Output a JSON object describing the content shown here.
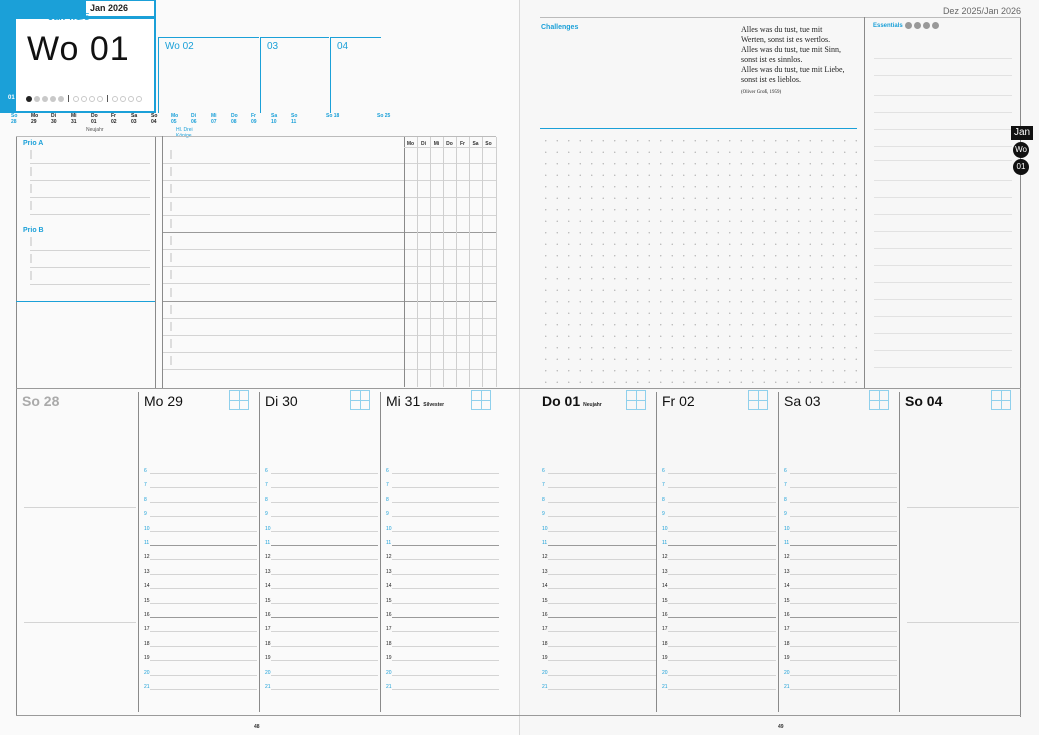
{
  "left_page": {
    "month_tab": "Jan 2026",
    "week_title": "Wo 01",
    "week_sub_month": "Jan",
    "week_sub_rest": "-w1/5",
    "week_num_small": "01",
    "day_strip": [
      {
        "d": "So",
        "n": "28",
        "c": true
      },
      {
        "d": "Mo",
        "n": "29",
        "c": false
      },
      {
        "d": "Di",
        "n": "30",
        "c": false
      },
      {
        "d": "Mi",
        "n": "31",
        "c": false
      },
      {
        "d": "Do",
        "n": "01",
        "c": false
      },
      {
        "d": "Fr",
        "n": "02",
        "c": false
      },
      {
        "d": "Sa",
        "n": "03",
        "c": false
      },
      {
        "d": "So",
        "n": "04",
        "c": false
      },
      {
        "d": "Mo",
        "n": "05",
        "c": true
      },
      {
        "d": "Di",
        "n": "06",
        "c": true
      },
      {
        "d": "Mi",
        "n": "07",
        "c": true
      },
      {
        "d": "Do",
        "n": "08",
        "c": true
      },
      {
        "d": "Fr",
        "n": "09",
        "c": true
      },
      {
        "d": "Sa",
        "n": "10",
        "c": true
      },
      {
        "d": "So",
        "n": "11",
        "c": true
      }
    ],
    "week_tabs": [
      "Wo 02",
      "03",
      "04"
    ],
    "week_tab_dates": [
      "So 18",
      "So 25"
    ],
    "holiday_neujahr": "Neujahr",
    "holiday_koenige": "Hl. Drei Könige",
    "prio_a": "Prio A",
    "prio_b": "Prio B",
    "habit_days": [
      "Mo",
      "Di",
      "Mi",
      "Do",
      "Fr",
      "Sa",
      "So"
    ],
    "page_number": "48"
  },
  "day_columns": [
    {
      "label": "So 28",
      "note": "",
      "style": "grey"
    },
    {
      "label": "Mo 29",
      "note": "",
      "style": "normal"
    },
    {
      "label": "Di 30",
      "note": "",
      "style": "normal"
    },
    {
      "label": "Mi 31",
      "note": "Silvester",
      "style": "normal"
    },
    {
      "label": "Do 01",
      "note": "Neujahr",
      "style": "bold"
    },
    {
      "label": "Fr 02",
      "note": "",
      "style": "normal"
    },
    {
      "label": "Sa 03",
      "note": "",
      "style": "normal"
    },
    {
      "label": "So 04",
      "note": "",
      "style": "bold"
    }
  ],
  "hours": [
    "6",
    "7",
    "8",
    "9",
    "10",
    "11",
    "12",
    "13",
    "14",
    "15",
    "16",
    "17",
    "18",
    "19",
    "20",
    "21"
  ],
  "right_page": {
    "header": "Dez 2025/Jan 2026",
    "challenges": "Challenges",
    "quote_lines": [
      "Alles was du tust, tue mit",
      "Werten, sonst ist es wertlos.",
      "Alles was du tust, tue mit Sinn,",
      "sonst ist es sinnlos.",
      "Alles was du tust, tue mit Liebe,",
      "sonst ist es lieblos."
    ],
    "quote_author": "(Oliver Groß, 1959)",
    "essentials": "Essentials",
    "side_month": "Jan",
    "side_wo": "Wo",
    "side_num": "01",
    "page_number": "49"
  },
  "colors": {
    "accent": "#1ba0d8",
    "ink": "#111111"
  }
}
